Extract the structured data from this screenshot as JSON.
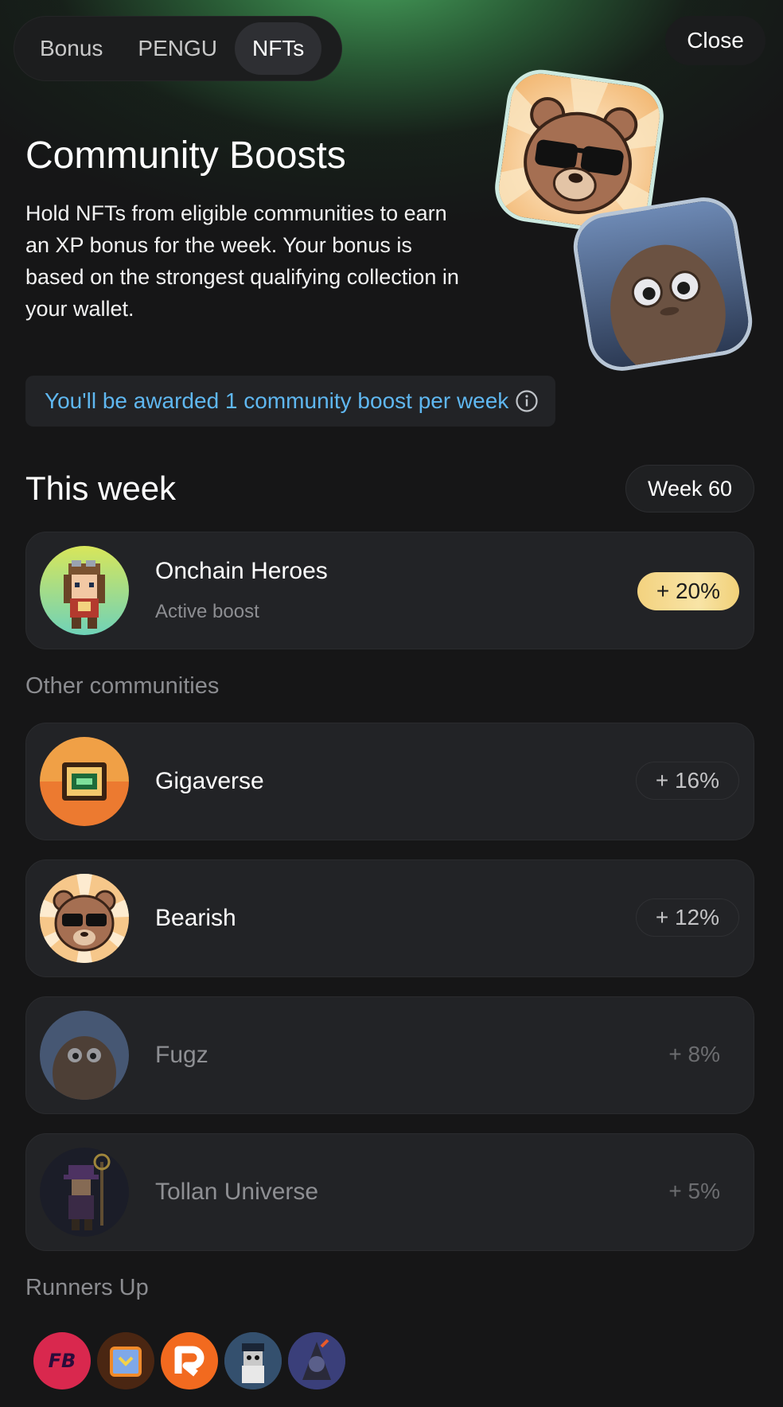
{
  "tabs": [
    {
      "label": "Bonus",
      "active": false
    },
    {
      "label": "PENGU",
      "active": false
    },
    {
      "label": "NFTs",
      "active": true
    }
  ],
  "close_label": "Close",
  "header": {
    "title": "Community Boosts",
    "description": "Hold NFTs from eligible communities to earn an XP bonus for the week. Your bonus is based on the strongest qualifying collection in your wallet."
  },
  "info_bar": {
    "text": "You'll be awarded 1 community boost per week",
    "icon": "info-icon"
  },
  "this_week": {
    "title": "This week",
    "week_label": "Week 60",
    "active": {
      "name": "Onchain Heroes",
      "status": "Active boost",
      "bonus": "+ 20%"
    }
  },
  "other": {
    "title": "Other communities",
    "items": [
      {
        "name": "Gigaverse",
        "bonus": "+ 16%"
      },
      {
        "name": "Bearish",
        "bonus": "+ 12%"
      },
      {
        "name": "Fugz",
        "bonus": "+ 8%"
      },
      {
        "name": "Tollan Universe",
        "bonus": "+ 5%"
      }
    ]
  },
  "runners_up": {
    "title": "Runners Up",
    "logos": [
      "fb-logo",
      "crate-logo",
      "r-logo",
      "pirate-logo",
      "wizard-logo"
    ],
    "fb_text": "FB"
  },
  "colors": {
    "accent_blue": "#5fb7f0",
    "gold": "#f3d27f",
    "background": "#161617",
    "card": "#222326"
  }
}
